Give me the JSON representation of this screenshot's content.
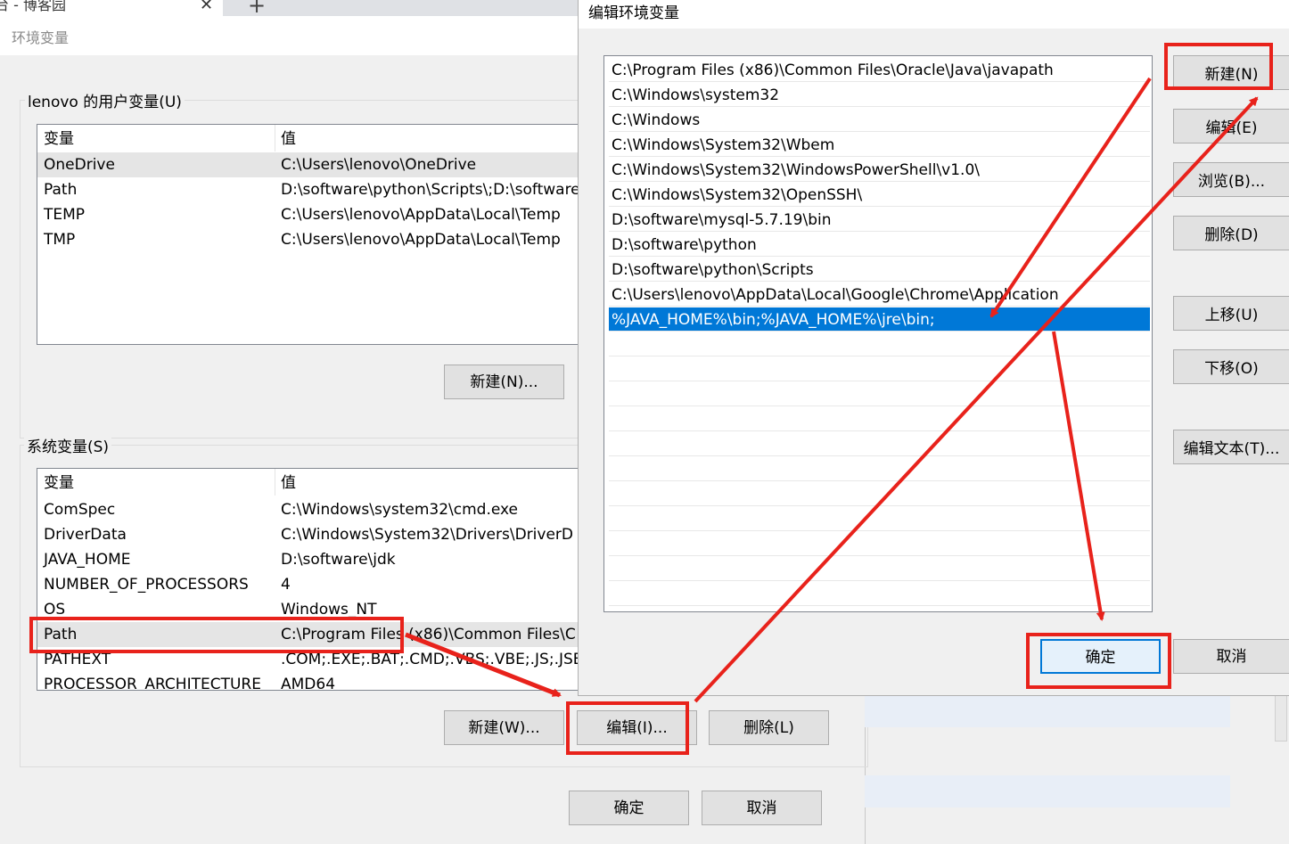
{
  "browser": {
    "tab_title": "台 - 博客园",
    "tab_close": "✕",
    "new_tab": "+"
  },
  "env_dialog": {
    "title": "环境变量",
    "user_group_label": "lenovo 的用户变量(U)",
    "system_group_label": "系统变量(S)",
    "columns": {
      "name": "变量",
      "value": "值"
    },
    "user_vars": [
      {
        "name": "OneDrive",
        "value": "C:\\Users\\lenovo\\OneDrive"
      },
      {
        "name": "Path",
        "value": "D:\\software\\python\\Scripts\\;D:\\software"
      },
      {
        "name": "TEMP",
        "value": "C:\\Users\\lenovo\\AppData\\Local\\Temp"
      },
      {
        "name": "TMP",
        "value": "C:\\Users\\lenovo\\AppData\\Local\\Temp"
      }
    ],
    "system_vars": [
      {
        "name": "ComSpec",
        "value": "C:\\Windows\\system32\\cmd.exe"
      },
      {
        "name": "DriverData",
        "value": "C:\\Windows\\System32\\Drivers\\DriverD"
      },
      {
        "name": "JAVA_HOME",
        "value": "D:\\software\\jdk"
      },
      {
        "name": "NUMBER_OF_PROCESSORS",
        "value": "4"
      },
      {
        "name": "OS",
        "value": "Windows_NT"
      },
      {
        "name": "Path",
        "value": "C:\\Program Files (x86)\\Common Files\\C"
      },
      {
        "name": "PATHEXT",
        "value": ".COM;.EXE;.BAT;.CMD;.VBS;.VBE;.JS;.JSE;."
      },
      {
        "name": "PROCESSOR_ARCHITECTURE",
        "value": "AMD64"
      }
    ],
    "user_new_button": "新建(N)...",
    "sys_new_button": "新建(W)...",
    "sys_edit_button": "编辑(I)...",
    "sys_delete_button": "删除(L)",
    "ok_button": "确定",
    "cancel_button": "取消"
  },
  "edit_dialog": {
    "title": "编辑环境变量",
    "paths": [
      "C:\\Program Files (x86)\\Common Files\\Oracle\\Java\\javapath",
      "C:\\Windows\\system32",
      "C:\\Windows",
      "C:\\Windows\\System32\\Wbem",
      "C:\\Windows\\System32\\WindowsPowerShell\\v1.0\\",
      "C:\\Windows\\System32\\OpenSSH\\",
      "D:\\software\\mysql-5.7.19\\bin",
      "D:\\software\\python",
      "D:\\software\\python\\Scripts",
      "C:\\Users\\lenovo\\AppData\\Local\\Google\\Chrome\\Application",
      "%JAVA_HOME%\\bin;%JAVA_HOME%\\jre\\bin;"
    ],
    "buttons": {
      "new": "新建(N)",
      "edit": "编辑(E)",
      "browse": "浏览(B)...",
      "delete": "删除(D)",
      "move_up": "上移(U)",
      "move_down": "下移(O)",
      "edit_text": "编辑文本(T)..."
    },
    "ok_button": "确定",
    "cancel_button": "取消"
  },
  "annotation_color": "#e8221b",
  "selection_color": "#0078d7"
}
